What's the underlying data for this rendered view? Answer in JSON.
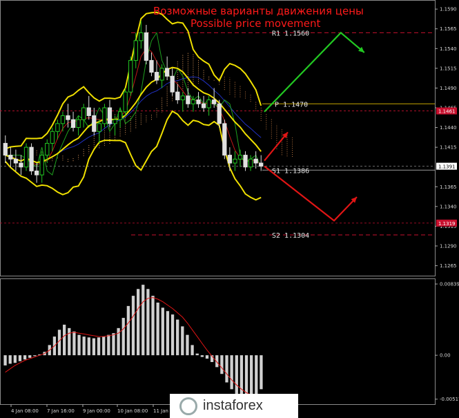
{
  "chart_data": [
    {
      "type": "line",
      "title": "Возможные варианты движения цены",
      "subtitle": "Possible price movement",
      "y_ticks": [
        "1.1590",
        "1.1565",
        "1.1540",
        "1.1515",
        "1.1490",
        "1.1465",
        "1.1440",
        "1.1415",
        "1.1365",
        "1.1340",
        "1.1315",
        "1.1290",
        "1.1265"
      ],
      "ylim": [
        1.1255,
        1.1598
      ],
      "x_ticks": [
        "4 Jan 08:00",
        "7 Jan 16:00",
        "9 Jan 00:00",
        "10 Jan 08:00",
        "11 Jan"
      ],
      "price_tags": [
        {
          "label": "1.1461",
          "value": 1.1461,
          "color": "#c8102e"
        },
        {
          "label": "1.1391",
          "value": 1.1391,
          "color": "#ffffff"
        },
        {
          "label": "1.1319",
          "value": 1.1319,
          "color": "#c8102e"
        }
      ],
      "levels": [
        {
          "label": "R1 1.1560",
          "value": 1.156,
          "color": "#c8102e",
          "style": "dashed"
        },
        {
          "label": "P 1.1470",
          "value": 1.147,
          "color": "#c8a600",
          "style": "solid"
        },
        {
          "label": "S1 1.1386",
          "value": 1.1386,
          "color": "#9a9a9a",
          "style": "solid"
        },
        {
          "label": "S2 1.1304",
          "value": 1.1304,
          "color": "#c8102e",
          "style": "dashed"
        }
      ],
      "candles": [
        [
          1.142,
          1.143,
          1.1395,
          1.1405
        ],
        [
          1.1405,
          1.1415,
          1.139,
          1.14
        ],
        [
          1.14,
          1.1412,
          1.1385,
          1.1395
        ],
        [
          1.1395,
          1.1405,
          1.138,
          1.139
        ],
        [
          1.139,
          1.142,
          1.1385,
          1.1415
        ],
        [
          1.1415,
          1.142,
          1.138,
          1.1385
        ],
        [
          1.1385,
          1.1395,
          1.137,
          1.138
        ],
        [
          1.138,
          1.141,
          1.137,
          1.1405
        ],
        [
          1.1405,
          1.1425,
          1.1395,
          1.142
        ],
        [
          1.142,
          1.144,
          1.141,
          1.1435
        ],
        [
          1.1435,
          1.145,
          1.1425,
          1.1445
        ],
        [
          1.1445,
          1.146,
          1.1435,
          1.1455
        ],
        [
          1.1455,
          1.147,
          1.144,
          1.145
        ],
        [
          1.145,
          1.146,
          1.1435,
          1.144
        ],
        [
          1.144,
          1.1455,
          1.143,
          1.145
        ],
        [
          1.145,
          1.147,
          1.144,
          1.1465
        ],
        [
          1.1465,
          1.148,
          1.145,
          1.1455
        ],
        [
          1.1455,
          1.1465,
          1.143,
          1.1435
        ],
        [
          1.1435,
          1.145,
          1.142,
          1.1445
        ],
        [
          1.1445,
          1.147,
          1.144,
          1.1465
        ],
        [
          1.1465,
          1.1475,
          1.144,
          1.1445
        ],
        [
          1.1445,
          1.1455,
          1.143,
          1.145
        ],
        [
          1.145,
          1.1465,
          1.144,
          1.146
        ],
        [
          1.146,
          1.149,
          1.1455,
          1.1485
        ],
        [
          1.1485,
          1.153,
          1.148,
          1.1525
        ],
        [
          1.1525,
          1.156,
          1.1515,
          1.155
        ],
        [
          1.155,
          1.1575,
          1.154,
          1.156
        ],
        [
          1.156,
          1.157,
          1.152,
          1.1525
        ],
        [
          1.1525,
          1.1535,
          1.1505,
          1.151
        ],
        [
          1.151,
          1.1525,
          1.1495,
          1.15
        ],
        [
          1.15,
          1.152,
          1.149,
          1.1515
        ],
        [
          1.1515,
          1.153,
          1.15,
          1.1505
        ],
        [
          1.1505,
          1.1515,
          1.148,
          1.1485
        ],
        [
          1.1485,
          1.1495,
          1.147,
          1.1475
        ],
        [
          1.1475,
          1.1485,
          1.146,
          1.148
        ],
        [
          1.148,
          1.149,
          1.1465,
          1.147
        ],
        [
          1.147,
          1.148,
          1.146,
          1.1475
        ],
        [
          1.1475,
          1.1485,
          1.1465,
          1.147
        ],
        [
          1.147,
          1.148,
          1.146,
          1.1465
        ],
        [
          1.1465,
          1.148,
          1.1455,
          1.1475
        ],
        [
          1.1475,
          1.149,
          1.1465,
          1.147
        ],
        [
          1.147,
          1.1475,
          1.144,
          1.1445
        ],
        [
          1.1445,
          1.145,
          1.14,
          1.1405
        ],
        [
          1.1405,
          1.1415,
          1.1385,
          1.1395
        ],
        [
          1.1395,
          1.141,
          1.1385,
          1.14
        ],
        [
          1.14,
          1.1412,
          1.139,
          1.1405
        ],
        [
          1.1405,
          1.141,
          1.1385,
          1.139
        ],
        [
          1.139,
          1.1405,
          1.1385,
          1.14
        ],
        [
          1.14,
          1.141,
          1.1388,
          1.1395
        ],
        [
          1.1395,
          1.1405,
          1.1385,
          1.1391
        ]
      ],
      "macd_ticks": [
        "0.00839",
        "0.00",
        "-0.00517"
      ],
      "macd_ylim": [
        -0.0056,
        0.0088
      ],
      "macd_hist": [
        -0.0012,
        -0.001,
        -0.0009,
        -0.0007,
        -0.0005,
        -0.0003,
        -0.0001,
        0.0001,
        0.0004,
        0.0012,
        0.0022,
        0.003,
        0.0036,
        0.0032,
        0.0028,
        0.0024,
        0.0022,
        0.0021,
        0.002,
        0.0021,
        0.0022,
        0.0024,
        0.0026,
        0.0032,
        0.0044,
        0.0058,
        0.007,
        0.0078,
        0.0083,
        0.0078,
        0.007,
        0.0062,
        0.0056,
        0.0052,
        0.0048,
        0.0042,
        0.0034,
        0.0024,
        0.0012,
        0.0002,
        -0.0002,
        -0.0004,
        -0.0008,
        -0.0014,
        -0.0022,
        -0.0032,
        -0.004,
        -0.0046,
        -0.005,
        -0.0052,
        -0.005,
        -0.0046,
        -0.004
      ],
      "macd_signal": [
        -0.002,
        -0.0016,
        -0.0012,
        -0.0009,
        -0.0006,
        -0.0004,
        -0.0002,
        0.0,
        0.0002,
        0.0006,
        0.0011,
        0.0017,
        0.0023,
        0.0026,
        0.0027,
        0.0026,
        0.0025,
        0.0024,
        0.0023,
        0.0022,
        0.0022,
        0.0023,
        0.0024,
        0.0026,
        0.0031,
        0.0038,
        0.0046,
        0.0055,
        0.0063,
        0.0067,
        0.0068,
        0.0066,
        0.0063,
        0.0059,
        0.0055,
        0.005,
        0.0045,
        0.0038,
        0.003,
        0.0022,
        0.0014,
        0.0006,
        -0.0001,
        -0.0008,
        -0.0015,
        -0.0022,
        -0.0029,
        -0.0035,
        -0.004,
        -0.0044,
        -0.0047,
        -0.0048,
        -0.0048
      ]
    }
  ],
  "logo": {
    "text": "instaforex"
  }
}
